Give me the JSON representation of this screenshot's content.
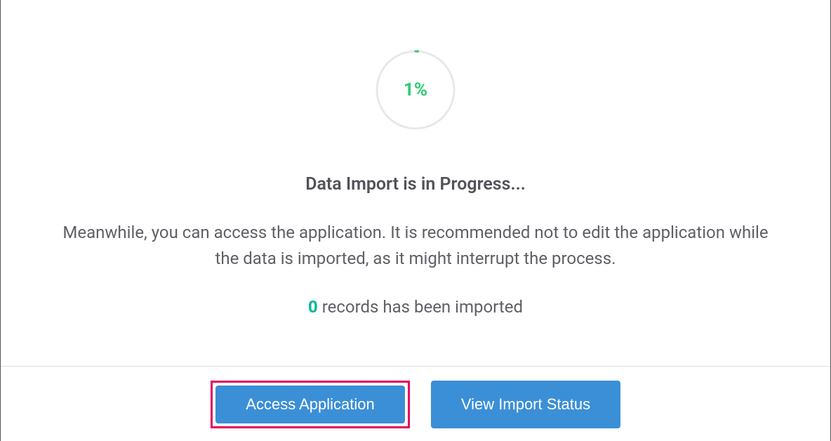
{
  "progress": {
    "percent_label": "1%",
    "percent_value": 1
  },
  "heading": "Data Import is in Progress...",
  "description": "Meanwhile, you can access the application. It is recommended not to edit the application while the data is imported, as it might interrupt the process.",
  "records": {
    "count": "0",
    "suffix": " records has been imported"
  },
  "buttons": {
    "access_label": "Access Application",
    "view_status_label": "View Import Status"
  },
  "colors": {
    "accent_green": "#2ecc71",
    "button_blue": "#3b8fd6",
    "highlight_pink": "#e6005c"
  }
}
